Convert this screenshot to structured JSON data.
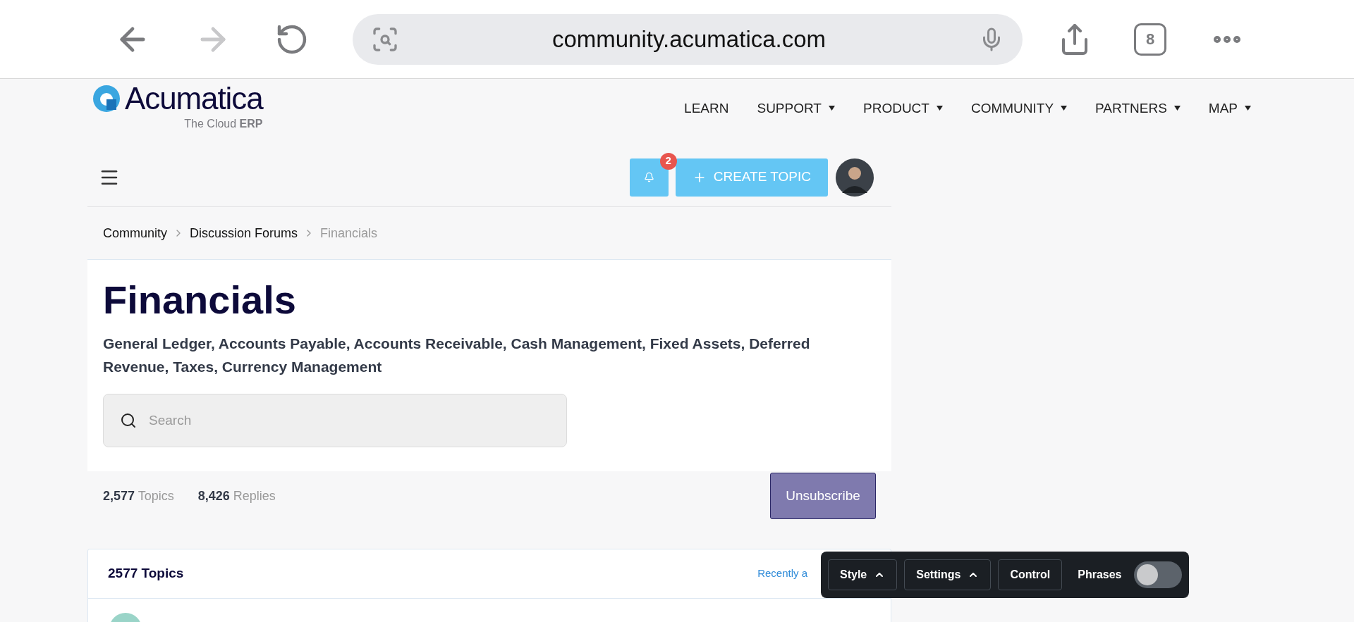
{
  "browser": {
    "url": "community.acumatica.com",
    "tab_count": "8"
  },
  "header": {
    "logo_text": "Acumatica",
    "tagline": "The Cloud",
    "tagline_bold": "ERP",
    "nav": [
      {
        "label": "LEARN",
        "dropdown": false
      },
      {
        "label": "SUPPORT",
        "dropdown": true
      },
      {
        "label": "PRODUCT",
        "dropdown": true
      },
      {
        "label": "COMMUNITY",
        "dropdown": true
      },
      {
        "label": "PARTNERS",
        "dropdown": true
      },
      {
        "label": "MAP",
        "dropdown": true
      }
    ]
  },
  "toolbar": {
    "notification_count": "2",
    "create_label": "CREATE TOPIC"
  },
  "breadcrumb": [
    {
      "label": "Community",
      "current": false
    },
    {
      "label": "Discussion Forums",
      "current": false
    },
    {
      "label": "Financials",
      "current": true
    }
  ],
  "forum": {
    "title": "Financials",
    "description": "General Ledger, Accounts Payable, Accounts Receivable, Cash Management, Fixed Assets, Deferred Revenue, Taxes, Currency Management",
    "search": {
      "placeholder": "Search"
    }
  },
  "stats": [
    "**2,577** Topics",
    "**8,426** Replies"
  ],
  "unsubscribe": "Unsubscribe",
  "topics": {
    "heading": "2577 Topics",
    "sort": "Recently a"
  },
  "overlay": {
    "buttons": [
      {
        "label": "Style",
        "caret": true
      },
      {
        "label": "Settings",
        "caret": true
      },
      {
        "label": "Control",
        "caret": false
      }
    ],
    "toggle": {
      "label": "Phrases",
      "on": false
    }
  }
}
